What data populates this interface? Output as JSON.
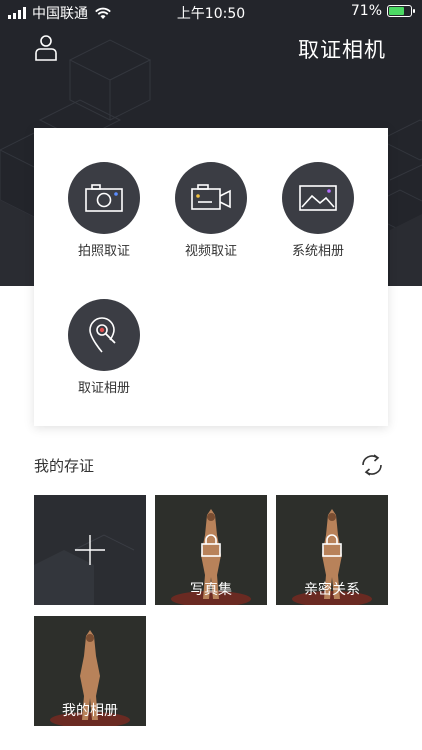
{
  "status_bar": {
    "carrier": "中国联通",
    "time": "上午10:50",
    "battery": "71%",
    "battery_level": 0.71
  },
  "header": {
    "title": "取证相机"
  },
  "actions": [
    {
      "label": "拍照取证",
      "icon": "camera-icon"
    },
    {
      "label": "视频取证",
      "icon": "video-camera-icon"
    },
    {
      "label": "系统相册",
      "icon": "gallery-icon"
    },
    {
      "label": "取证相册",
      "icon": "location-search-icon"
    }
  ],
  "section": {
    "title": "我的存证"
  },
  "albums": [
    {
      "label": "",
      "type": "add"
    },
    {
      "label": "写真集",
      "type": "locked"
    },
    {
      "label": "亲密关系",
      "type": "locked"
    },
    {
      "label": "我的相册",
      "type": "open"
    }
  ],
  "colors": {
    "header_bg": "#23252b",
    "icon_circle": "#3b3d44",
    "battery_green": "#4cd964"
  }
}
